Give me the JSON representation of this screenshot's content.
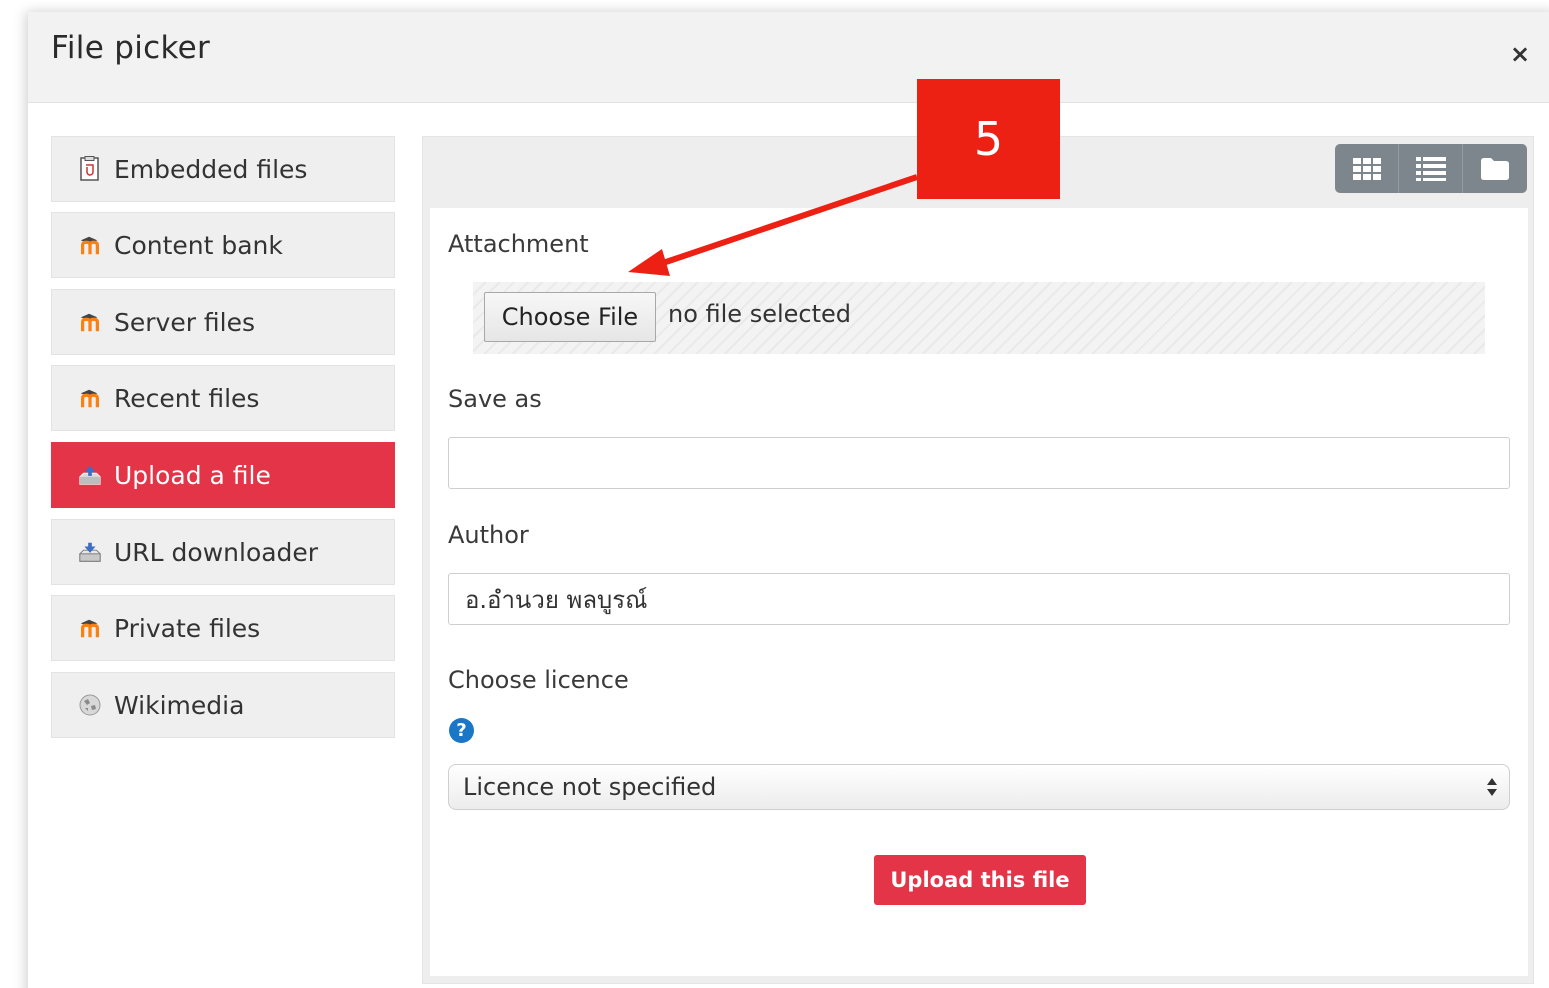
{
  "dialog": {
    "title": "File picker",
    "close_label": "×"
  },
  "sidebar": {
    "items": [
      {
        "label": "Embedded files",
        "icon": "embedded-files-icon"
      },
      {
        "label": "Content bank",
        "icon": "moodle-icon"
      },
      {
        "label": "Server files",
        "icon": "moodle-icon"
      },
      {
        "label": "Recent files",
        "icon": "moodle-icon"
      },
      {
        "label": "Upload a file",
        "icon": "upload-icon",
        "active": true
      },
      {
        "label": "URL downloader",
        "icon": "download-icon"
      },
      {
        "label": "Private files",
        "icon": "moodle-icon"
      },
      {
        "label": "Wikimedia",
        "icon": "wikimedia-icon"
      }
    ]
  },
  "toolbar": {
    "views": [
      "grid-view-icon",
      "list-view-icon",
      "folder-view-icon"
    ]
  },
  "form": {
    "attachment_label": "Attachment",
    "choose_file_label": "Choose File",
    "no_file_text": "no file selected",
    "save_as_label": "Save as",
    "save_as_value": "",
    "author_label": "Author",
    "author_value": "อ.อำนวย พลบูรณ์",
    "licence_label": "Choose licence",
    "licence_help": "?",
    "licence_selected": "Licence not specified",
    "upload_button": "Upload this file"
  },
  "annotation": {
    "step_number": "5"
  },
  "colors": {
    "accent": "#e43447",
    "callout": "#ec2013",
    "view_button": "#7d858d",
    "help": "#1a76c6",
    "moodle_orange": "#f98012"
  }
}
